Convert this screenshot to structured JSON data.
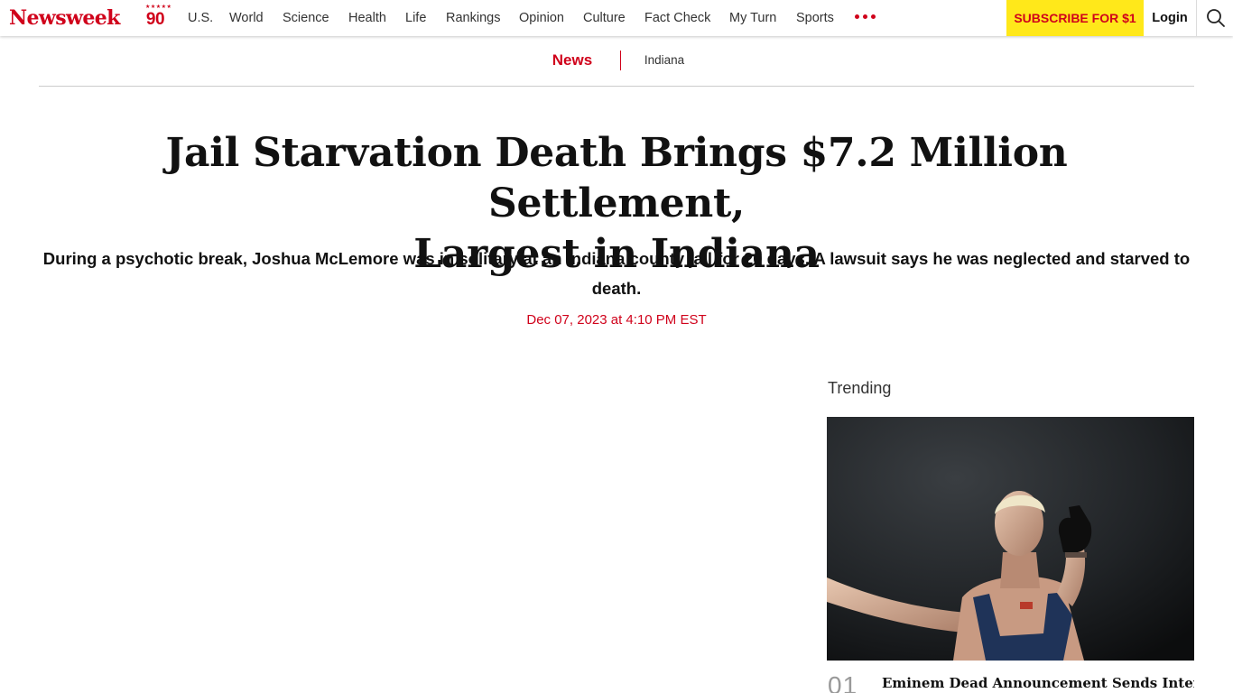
{
  "brand": {
    "logo_text": "Newsweek",
    "anniversary": "90",
    "accent_color": "#d0021b"
  },
  "nav": {
    "items": [
      "U.S.",
      "World",
      "Science",
      "Health",
      "Life",
      "Rankings",
      "Opinion",
      "Culture",
      "Fact Check",
      "My Turn",
      "Sports"
    ],
    "more_icon": "more-dots-icon",
    "subscribe_label": "SUBSCRIBE FOR $1",
    "subscribe_color": "#ffe81a",
    "login_label": "Login",
    "search_icon": "search-icon"
  },
  "breadcrumb": {
    "section": "News",
    "tag": "Indiana"
  },
  "article": {
    "headline_line1": "Jail Starvation Death Brings $7.2 Million Settlement,",
    "headline_line2": "Largest in Indiana",
    "dek": "During a psychotic break, Joshua McLemore was in solitary at an Indiana county jail for 20 days. A lawsuit says he was neglected and starved to death.",
    "date": "Dec 07, 2023 at 4:10 PM EST"
  },
  "trending": {
    "title": "Trending",
    "items": [
      {
        "number": "01",
        "title": "Eminem Dead Announcement Sends Internet"
      }
    ]
  }
}
